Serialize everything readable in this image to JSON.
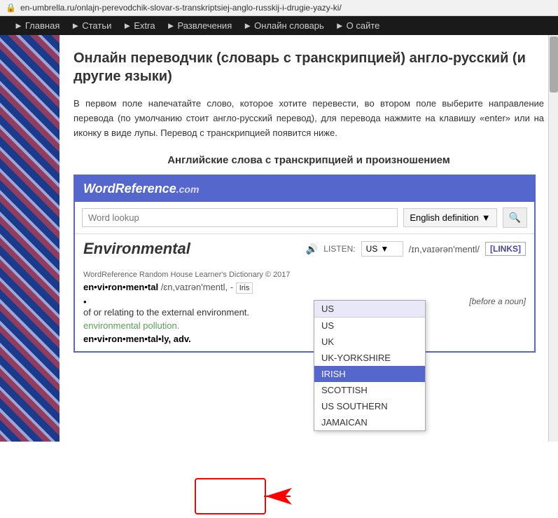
{
  "address_bar": {
    "url": "en-umbrella.ru/onlajn-perevodchik-slovar-s-transkriptsiej-anglo-russkij-i-drugie-yazy-ki/",
    "lock_icon": "🔒"
  },
  "nav": {
    "items": [
      {
        "arrow": "►",
        "label": "Главная"
      },
      {
        "arrow": "►",
        "label": "Статьи"
      },
      {
        "arrow": "►",
        "label": "Extra"
      },
      {
        "arrow": "►",
        "label": "Развлечения"
      },
      {
        "arrow": "►",
        "label": "Онлайн словарь"
      },
      {
        "arrow": "►",
        "label": "О сайте"
      }
    ]
  },
  "page_title": "Онлайн переводчик (словарь с транскрипцией) англо-русский (и другие языки)",
  "description": "В первом поле напечатайте слово, которое хотите перевести, во втором поле выберите направление перевода (по умолчанию стоит англо-русский перевод), для перевода нажмите на клавишу «enter» или на иконку в виде лупы. Перевод с транскрипцией появится ниже.",
  "section_heading": "Английские слова с транскрипцией и произношением",
  "wordreference": {
    "logo_word": "WordReference",
    "logo_dotcom": ".com",
    "search_placeholder": "Word lookup",
    "lang_button": "English definition",
    "lang_arrow": "▼",
    "search_icon": "🔍",
    "word": "Environmental",
    "listen_label": "LISTEN:",
    "listen_icon": "🔊",
    "selected_accent": "US",
    "links_label": "[LINKS]",
    "transcription": "/ɪn,vaɪərən'mentl/",
    "dropdown_items": [
      "US",
      "UK",
      "UK-YORKSHIRE",
      "IRISH",
      "SCOTTISH",
      "US SOUTHERN",
      "JAMAICAN"
    ],
    "selected_dropdown": "IRISH",
    "dict_source": "WordReference Random House Learner's Dictionary © 2017",
    "phonetic": "en•vi•ron•men•tal",
    "phonetic_ipa": "/ɛn,vaɪrən'mentl, -",
    "before_noun": "[before a noun]",
    "iris_badge": "Iris",
    "bullet": "•",
    "def_text": "of or relating to the external environment.",
    "def_example": "environmental pollution.",
    "def_adv": "en•vi•ron•men•tal•ly, adv."
  }
}
